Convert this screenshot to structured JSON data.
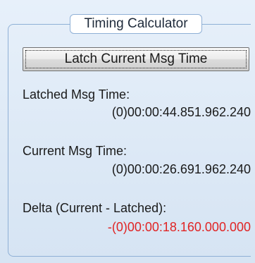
{
  "group": {
    "title": "Timing Calculator"
  },
  "latch_button": {
    "label": "Latch Current Msg Time"
  },
  "latched": {
    "label": "Latched Msg Time:",
    "value": "(0)00:00:44.851.962.240"
  },
  "current": {
    "label": "Current Msg Time:",
    "value": "(0)00:00:26.691.962.240"
  },
  "delta": {
    "label": "Delta (Current - Latched):",
    "value": "-(0)00:00:18.160.000.000",
    "color": "#e02424"
  },
  "colors": {
    "background": "#dde9f6",
    "group_border": "#8fb0d6"
  }
}
